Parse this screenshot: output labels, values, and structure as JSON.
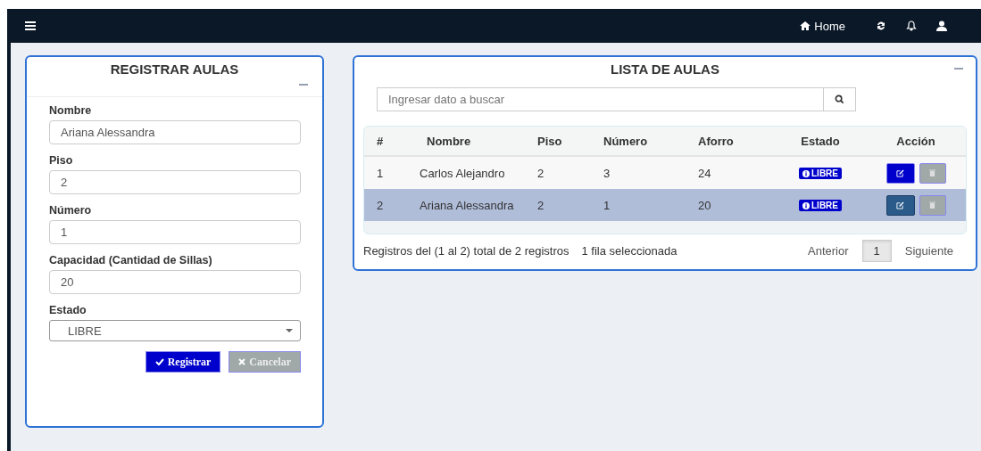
{
  "navbar": {
    "home_label": "Home"
  },
  "form": {
    "title": "REGISTRAR AULAS",
    "fields": [
      {
        "kind": "input",
        "label": "Nombre",
        "value": "Ariana Alessandra"
      },
      {
        "kind": "input",
        "label": "Piso",
        "value": "2"
      },
      {
        "kind": "input",
        "label": "Número",
        "value": "1"
      },
      {
        "kind": "input",
        "label": "Capacidad (Cantidad de Sillas)",
        "value": "20"
      },
      {
        "kind": "select",
        "label": "Estado",
        "value": "LIBRE"
      }
    ],
    "buttons": [
      {
        "kind": "primary",
        "label": "Registrar"
      },
      {
        "kind": "cancel",
        "label": "Cancelar"
      }
    ]
  },
  "list": {
    "title": "LISTA DE AULAS",
    "search": {
      "placeholder": "Ingresar dato a buscar"
    },
    "columns": [
      "#",
      "Nombre",
      "Piso",
      "Número",
      "Aforro",
      "Estado",
      "Acción"
    ],
    "rows": [
      {
        "num": "1",
        "nombre": "Carlos Alejandro",
        "piso": "2",
        "numero": "3",
        "aforro": "24",
        "estado": "LIBRE",
        "selected": false
      },
      {
        "num": "2",
        "nombre": "Ariana Alessandra",
        "piso": "2",
        "numero": "1",
        "aforro": "20",
        "estado": "LIBRE",
        "selected": true
      }
    ],
    "info": "Registros del (1 al 2) total de 2 registros",
    "selection_info": "1 fila seleccionada",
    "pagination": {
      "previous": "Anterior",
      "pages": [
        {
          "label": "1",
          "selected": true
        }
      ],
      "next": "Siguiente"
    }
  }
}
